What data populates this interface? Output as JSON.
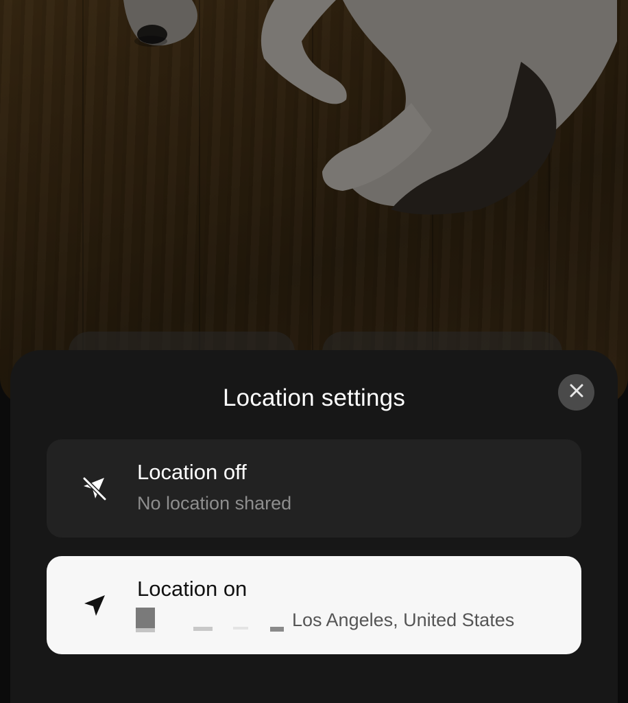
{
  "sheet": {
    "title": "Location settings",
    "close_icon": "close-icon"
  },
  "options": [
    {
      "id": "location-off",
      "title": "Location off",
      "subtitle": "No location shared",
      "icon": "location-off-icon",
      "selected": false
    },
    {
      "id": "location-on",
      "title": "Location on",
      "subtitle": "Los Angeles, United States",
      "icon": "location-arrow-icon",
      "selected": true
    }
  ],
  "colors": {
    "sheet_background": "#171717",
    "option_background": "#222222",
    "selected_option_background": "#f7f7f7",
    "close_button": "#4a4a4a"
  }
}
